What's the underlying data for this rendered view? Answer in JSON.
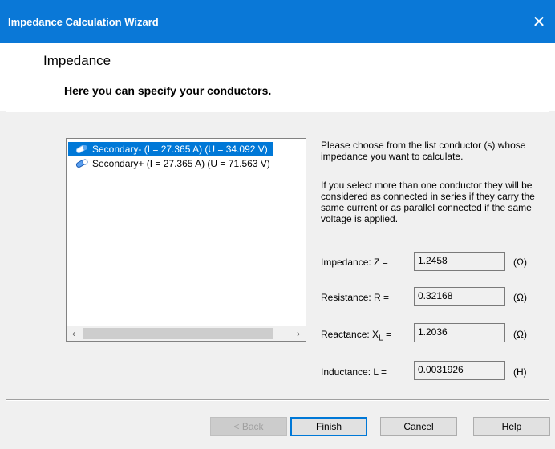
{
  "window": {
    "title": "Impedance Calculation Wizard",
    "close_glyph": "✕"
  },
  "header": {
    "title": "Impedance",
    "subtitle": "Here you can specify your conductors."
  },
  "conductors": [
    {
      "label": "Secondary- (I = 27.365 A) (U = 34.092 V)",
      "selected": true,
      "icon": "conductor-icon"
    },
    {
      "label": "Secondary+ (I = 27.365 A) (U = 71.563 V)",
      "selected": false,
      "icon": "conductor-icon"
    }
  ],
  "scroll": {
    "left": "‹",
    "right": "›"
  },
  "help_text": {
    "p1": "Please choose from the list conductor (s) whose impedance you want to calculate.",
    "p2": "If you select more than one conductor they will be considered as connected in series if they carry the same current or as parallel connected if the same voltage is applied."
  },
  "fields": {
    "impedance": {
      "label": "Impedance:  Z =",
      "value": "1.2458",
      "unit": "(Ω)"
    },
    "resistance": {
      "label": "Resistance:  R =",
      "value": "0.32168",
      "unit": "(Ω)"
    },
    "reactance": {
      "label_prefix": "Reactance:  X",
      "label_sub": "L",
      "label_suffix": " =",
      "value": "1.2036",
      "unit": "(Ω)"
    },
    "inductance": {
      "label": "Inductance:  L =",
      "value": "0.0031926",
      "unit": "(H)"
    }
  },
  "buttons": {
    "back": "< Back",
    "finish": "Finish",
    "cancel": "Cancel",
    "help": "Help"
  },
  "colors": {
    "titlebar": "#0a78d7",
    "selection": "#0078d7"
  }
}
